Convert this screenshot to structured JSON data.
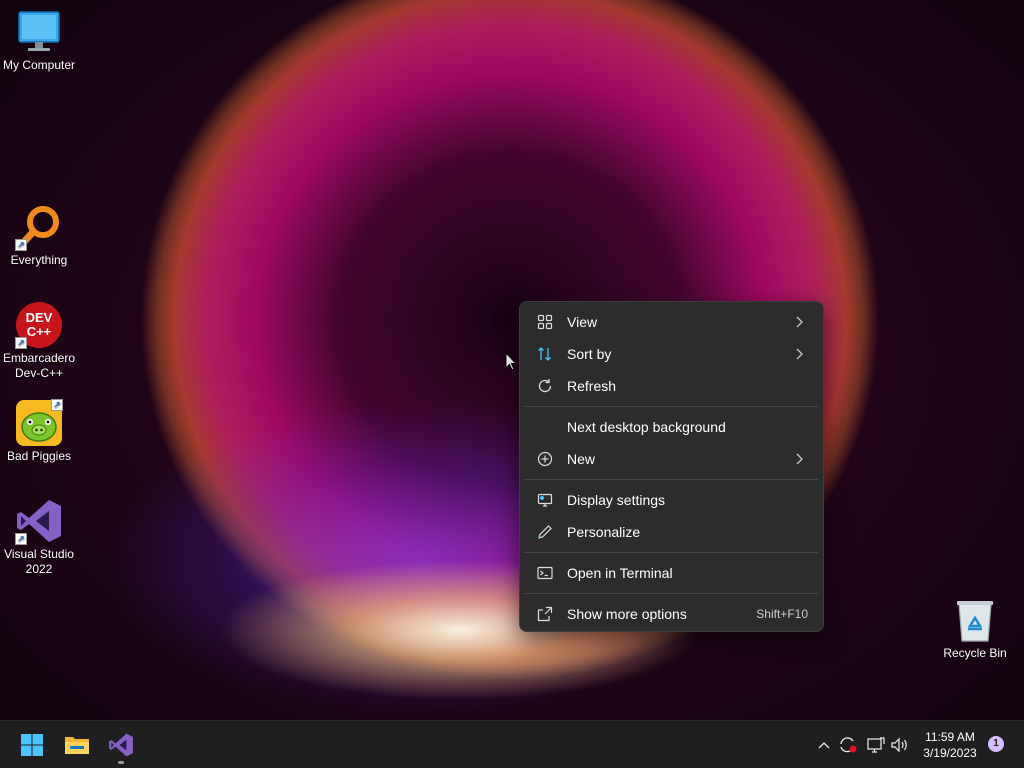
{
  "desktop": {
    "icons": [
      {
        "label": "My Computer",
        "icon": "monitor-icon"
      },
      {
        "label": "Everything",
        "icon": "magnifier-icon"
      },
      {
        "label": "Embarcadero Dev-C++",
        "icon": "devcpp-icon",
        "art_text": "DEV C++"
      },
      {
        "label": "Bad Piggies",
        "icon": "bad-piggies-icon"
      },
      {
        "label": "Visual Studio 2022",
        "icon": "visual-studio-icon"
      },
      {
        "label": "Recycle Bin",
        "icon": "recycle-bin-icon"
      }
    ]
  },
  "context_menu": {
    "items": [
      {
        "label": "View",
        "icon": "grid-icon",
        "submenu": true
      },
      {
        "label": "Sort by",
        "icon": "sort-icon",
        "submenu": true
      },
      {
        "label": "Refresh",
        "icon": "refresh-icon",
        "submenu": false
      },
      {
        "label": "Next desktop background",
        "icon": "",
        "submenu": false
      },
      {
        "label": "New",
        "icon": "plus-circle-icon",
        "submenu": true
      },
      {
        "label": "Display settings",
        "icon": "display-icon",
        "submenu": false
      },
      {
        "label": "Personalize",
        "icon": "pencil-icon",
        "submenu": false
      },
      {
        "label": "Open in Terminal",
        "icon": "terminal-icon",
        "submenu": false
      },
      {
        "label": "Show more options",
        "icon": "share-icon",
        "submenu": false,
        "shortcut": "Shift+F10"
      }
    ]
  },
  "taskbar": {
    "pinned": [
      "windows-start-icon",
      "file-explorer-icon",
      "visual-studio-icon"
    ],
    "tray": [
      "chevron-up-icon",
      "sync-icon",
      "network-icon",
      "volume-icon"
    ],
    "time": "11:59 AM",
    "date": "3/19/2023",
    "notification_count": "1"
  },
  "colors": {
    "menu_bg": "#2c2c2c",
    "taskbar_bg": "#1f1f1f",
    "accent": "#0078d4"
  }
}
